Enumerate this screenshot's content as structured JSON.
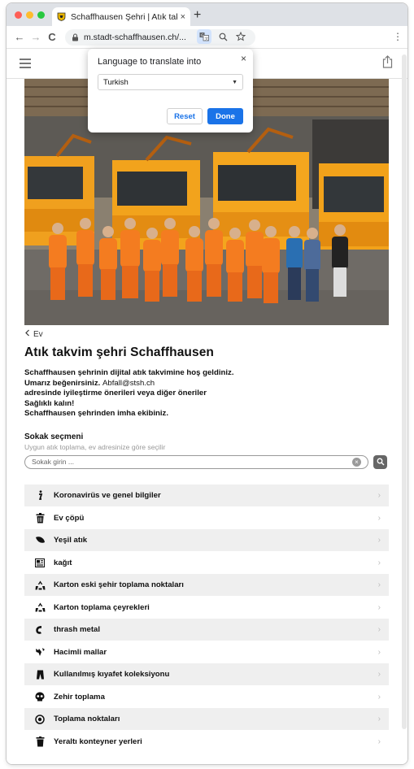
{
  "browser": {
    "tab_title": "Schaffhausen Şehri | Atık takvi",
    "tab_close": "×",
    "new_tab": "+",
    "url": "m.stadt-schaffhausen.ch/...",
    "back": "←",
    "forward": "→",
    "reload": "C",
    "menu": "⋮",
    "icons": [
      "favicon-crest-icon",
      "lock-icon",
      "translate-icon",
      "zoom-icon",
      "bookmark-star-icon"
    ]
  },
  "translate_popup": {
    "title": "Language to translate into",
    "close": "×",
    "selected_language": "Turkish",
    "reset_label": "Reset",
    "done_label": "Done",
    "accent_color": "#1a73e8"
  },
  "page": {
    "back_label": "Ev",
    "title": "Atık takvim şehri Schaffhausen",
    "intro": {
      "line1": "Schaffhausen şehrinin dijital atık takvimine hoş geldiniz.",
      "line2_prefix": "Umarız beğenirsiniz.",
      "email": "Abfall@stsh.ch",
      "line3": "adresinde iyileştirme önerileri veya diğer öneriler",
      "line4": "Sağlıklı kalın!",
      "line5": "Schaffhausen şehrinden imha ekibiniz."
    },
    "street": {
      "heading": "Sokak seçmeni",
      "subheading": "Uygun atık toplama, ev adresinize göre seçilir",
      "placeholder": "Sokak girin ...",
      "clear": "×"
    },
    "categories": [
      {
        "label": "Koronavirüs ve genel bilgiler",
        "icon": "info-icon"
      },
      {
        "label": "Ev çöpü",
        "icon": "trash-can-icon"
      },
      {
        "label": "Yeşil atık",
        "icon": "leaf-icon"
      },
      {
        "label": "kağıt",
        "icon": "newspaper-icon"
      },
      {
        "label": "Karton eski şehir toplama noktaları",
        "icon": "recycle-icon"
      },
      {
        "label": "Karton toplama çeyrekleri",
        "icon": "recycle-icon"
      },
      {
        "label": "thrash metal",
        "icon": "metal-icon"
      },
      {
        "label": "Hacimli mallar",
        "icon": "bulky-goods-icon"
      },
      {
        "label": "Kullanılmış kıyafet koleksiyonu",
        "icon": "clothing-icon"
      },
      {
        "label": "Zehir toplama",
        "icon": "skull-icon"
      },
      {
        "label": "Toplama noktaları",
        "icon": "location-dot-icon"
      },
      {
        "label": "Yeraltı konteyner yerleri",
        "icon": "underground-container-icon"
      }
    ],
    "chevron": "›"
  }
}
